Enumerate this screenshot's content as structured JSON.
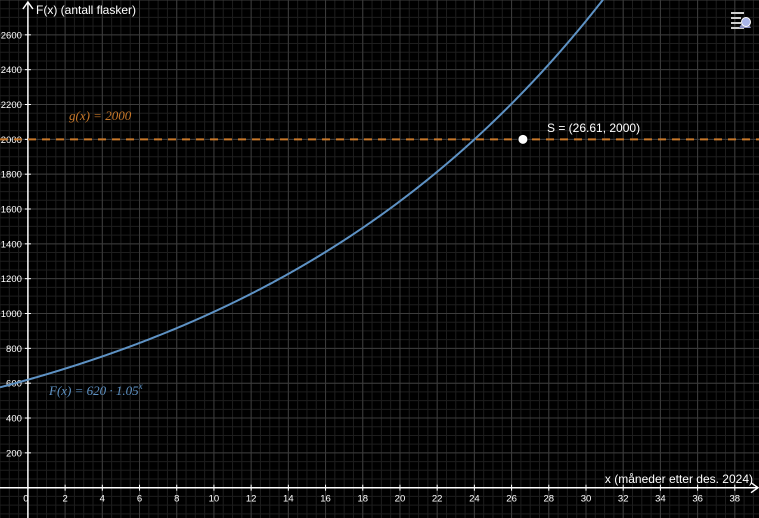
{
  "axes": {
    "x_label": "x (måneder etter des. 2024)",
    "y_label": "F(x) (antall flasker)",
    "x_ticks": [
      "0",
      "2",
      "4",
      "6",
      "8",
      "10",
      "12",
      "14",
      "16",
      "18",
      "20",
      "22",
      "24",
      "26",
      "28",
      "30",
      "32",
      "34",
      "36",
      "38"
    ],
    "y_ticks": [
      "200",
      "400",
      "600",
      "800",
      "1000",
      "1200",
      "1400",
      "1600",
      "1800",
      "2000",
      "2200",
      "2400",
      "2600"
    ]
  },
  "functions": {
    "F_label": "F(x) = 620 · 1.05",
    "F_exponent": "x",
    "g_label": "g(x) = 2000"
  },
  "point": {
    "label": "S = (26.61, 2000)"
  },
  "colors": {
    "background": "#000000",
    "grid_major": "#3c3c3c",
    "grid_minor": "#1e1e1e",
    "curve": "#5e92c4",
    "line_g": "#c8782a",
    "point_fill": "#ffffff"
  },
  "icons": {
    "menu": "graphing-menu-icon"
  },
  "chart_data": {
    "type": "line",
    "series": [
      {
        "name": "F(x) = 620 · 1.05^x",
        "formula": "620*1.05^x",
        "base": 620,
        "growth": 1.05
      },
      {
        "name": "g(x) = 2000",
        "formula": "2000",
        "value": 2000
      }
    ],
    "intersection": {
      "x": 26.61,
      "y": 2000
    },
    "xlabel": "x (måneder etter des. 2024)",
    "ylabel": "F(x) (antall flasker)",
    "xlim": [
      -1.5,
      39.3
    ],
    "ylim": [
      -174,
      2800
    ],
    "x_tick_step": 2,
    "y_tick_step": 200,
    "grid": true
  }
}
